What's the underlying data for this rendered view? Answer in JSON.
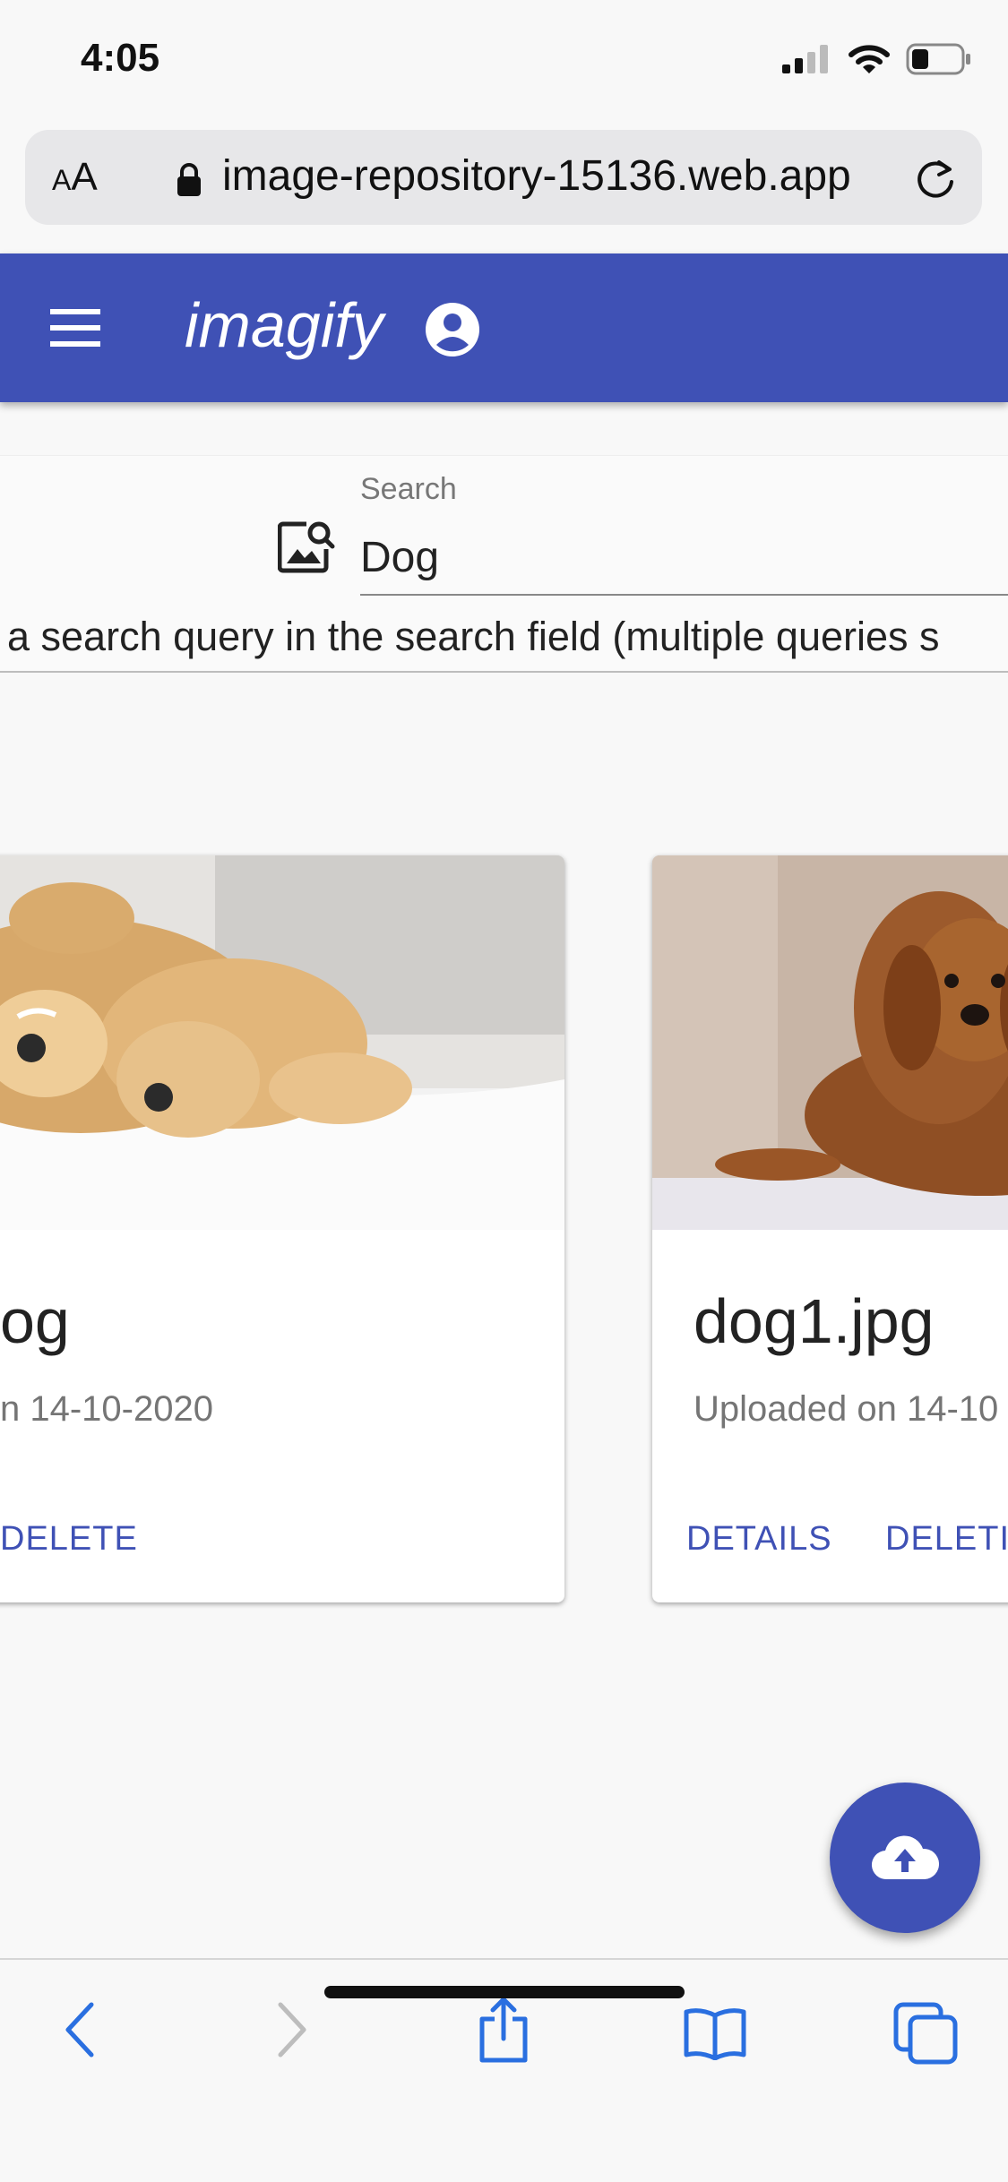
{
  "status_bar": {
    "time": "4:05"
  },
  "browser": {
    "text_size_label_small": "A",
    "text_size_label_large": "A",
    "url": "image-repository-15136.web.app"
  },
  "app_bar": {
    "title": "imagify"
  },
  "search": {
    "label": "Search",
    "value": "Dog",
    "hint": "a search query in the search field (multiple queries s"
  },
  "cards": [
    {
      "title": "og",
      "subtitle": "n 14-10-2020",
      "actions": [
        "DELETE"
      ]
    },
    {
      "title": "dog1.jpg",
      "subtitle": "Uploaded on 14-10",
      "actions": [
        "DETAILS",
        "DELETI"
      ]
    }
  ],
  "colors": {
    "primary": "#3f51b5",
    "ios_blue": "#2a6fe0"
  },
  "icons": [
    "menu-icon",
    "account-circle-icon",
    "image-search-icon",
    "cloud-upload-icon",
    "lock-icon",
    "reload-icon",
    "back-icon",
    "forward-icon",
    "share-icon",
    "bookmarks-icon",
    "tabs-icon"
  ]
}
